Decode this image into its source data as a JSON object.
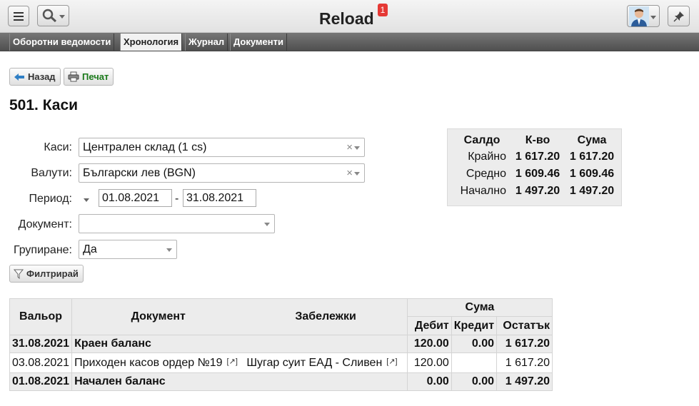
{
  "app": {
    "title": "Reload",
    "notification_count": "1"
  },
  "tabs": [
    {
      "label": "Оборотни ведомости"
    },
    {
      "label": "Хронология"
    },
    {
      "label": "Журнал"
    },
    {
      "label": "Документи"
    }
  ],
  "toolbar": {
    "back_label": "Назад",
    "print_label": "Печат"
  },
  "page": {
    "title": "501. Каси"
  },
  "form": {
    "kasi_label": "Каси:",
    "kasi_value": "Централен склад (1 cs)",
    "currency_label": "Валути:",
    "currency_value": "Български лев (BGN)",
    "period_label": "Период:",
    "date_from": "01.08.2021",
    "date_sep": "-",
    "date_to": "31.08.2021",
    "document_label": "Документ:",
    "document_value": "",
    "grouping_label": "Групиране:",
    "grouping_value": "Да",
    "clear_symbol": "×",
    "filter_label": "Филтрирай"
  },
  "saldo": {
    "headers": [
      "Салдо",
      "К-во",
      "Сума"
    ],
    "rows": [
      {
        "label": "Крайно",
        "qty": "1 617.20",
        "sum": "1 617.20"
      },
      {
        "label": "Средно",
        "qty": "1 609.46",
        "sum": "1 609.46"
      },
      {
        "label": "Начално",
        "qty": "1 497.20",
        "sum": "1 497.20"
      }
    ]
  },
  "table": {
    "headers": {
      "valor": "Вальор",
      "document": "Документ",
      "notes": "Забележки",
      "sum": "Сума",
      "debit": "Дебит",
      "credit": "Кредит",
      "balance": "Остатък"
    },
    "ext_link": "[↗]",
    "rows": [
      {
        "date": "31.08.2021",
        "doc": "Краен баланс",
        "notes": "",
        "debit": "120.00",
        "credit": "0.00",
        "balance": "1 617.20"
      },
      {
        "date": "03.08.2021",
        "doc": "Приходен касов ордер №19",
        "notes": "Шугар суит ЕАД - Сливен",
        "debit": "120.00",
        "credit": "",
        "balance": "1 617.20"
      },
      {
        "date": "01.08.2021",
        "doc": "Начален баланс",
        "notes": "",
        "debit": "0.00",
        "credit": "0.00",
        "balance": "1 497.20"
      }
    ]
  },
  "icons": {
    "menu": "hamburger-icon",
    "search": "search-icon",
    "user": "user-avatar-icon",
    "pin": "pin-icon",
    "back": "back-arrow-icon",
    "print": "printer-icon",
    "filter": "funnel-icon"
  }
}
